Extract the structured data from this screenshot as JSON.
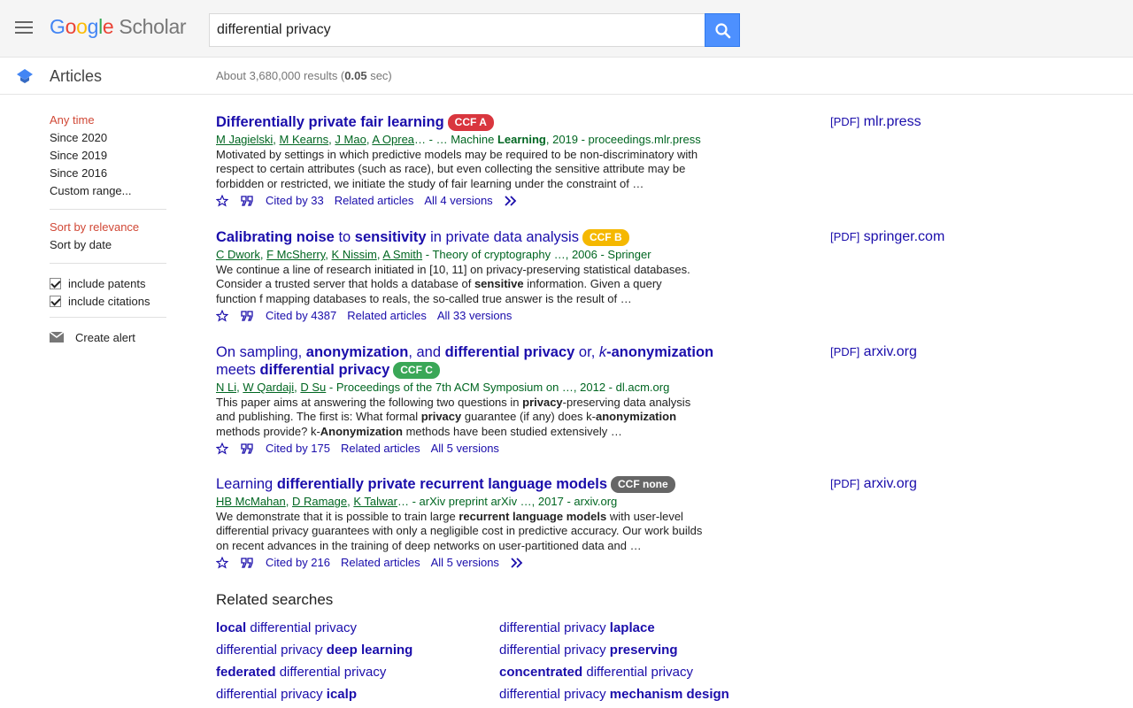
{
  "header": {
    "logo_google": [
      "G",
      "o",
      "o",
      "g",
      "l",
      "e"
    ],
    "logo_scholar": "Scholar",
    "search_value": "differential privacy"
  },
  "subheader": {
    "section_title": "Articles",
    "result_count_prefix": "About 3,680,000 results (",
    "result_count_time": "0.05",
    "result_count_suffix": " sec)"
  },
  "sidebar": {
    "time_filters": [
      "Any time",
      "Since 2020",
      "Since 2019",
      "Since 2016",
      "Custom range..."
    ],
    "sort_options": [
      "Sort by relevance",
      "Sort by date"
    ],
    "checkboxes": [
      "include patents",
      "include citations"
    ],
    "create_alert": "Create alert"
  },
  "results": [
    {
      "title_parts": [
        [
          "Differentially private fair learning",
          true
        ]
      ],
      "badge": "CCF A",
      "badge_color": "#d9363e",
      "meta_authors": [
        "M Jagielski",
        "M Kearns",
        "J Mao",
        "A Oprea"
      ],
      "meta_rest_before": "… - … Machine ",
      "meta_rest_bold": "Learning",
      "meta_rest_after": ", 2019 - proceedings.mlr.press",
      "snippet_parts": [
        [
          "Motivated by settings in which predictive models may be required to be non-discriminatory with respect to certain attributes (such as race), but even collecting the sensitive attribute may be forbidden or restricted, we initiate the study of fair learning under the constraint of …",
          false
        ]
      ],
      "cited": "Cited by 33",
      "related": "Related articles",
      "versions": "All 4 versions",
      "pdf_tag": "[PDF]",
      "pdf_site": "mlr.press"
    },
    {
      "title_parts": [
        [
          "Calibrating noise",
          true
        ],
        [
          " to ",
          false
        ],
        [
          "sensitivity",
          true
        ],
        [
          " in private data analysis",
          false
        ]
      ],
      "badge": "CCF B",
      "badge_color": "#f5b800",
      "meta_authors": [
        "C Dwork",
        "F McSherry",
        "K Nissim",
        "A Smith"
      ],
      "meta_rest_before": " - Theory of cryptography …, 2006 - Springer",
      "meta_rest_bold": "",
      "meta_rest_after": "",
      "snippet_parts": [
        [
          "We continue a line of research initiated in [10, 11] on privacy-preserving statistical databases. Consider a trusted server that holds a database of ",
          false
        ],
        [
          "sensitive",
          true
        ],
        [
          " information. Given a query function f mapping databases to reals, the so-called true answer is the result of …",
          false
        ]
      ],
      "cited": "Cited by 4387",
      "related": "Related articles",
      "versions": "All 33 versions",
      "pdf_tag": "[PDF]",
      "pdf_site": "springer.com"
    },
    {
      "title_parts": [
        [
          "On sampling, ",
          false
        ],
        [
          "anonymization",
          true
        ],
        [
          ", and ",
          false
        ],
        [
          "differential privacy",
          true
        ],
        [
          " or, ",
          false
        ],
        [
          "k",
          false,
          true
        ],
        [
          "-anonymization",
          true
        ],
        [
          " meets ",
          false
        ],
        [
          "differential privacy",
          true
        ]
      ],
      "badge": "CCF C",
      "badge_color": "#3aa757",
      "meta_authors": [
        "N Li",
        "W Qardaji",
        "D Su"
      ],
      "meta_rest_before": " - Proceedings of the 7th ACM Symposium on …, 2012 - dl.acm.org",
      "meta_rest_bold": "",
      "meta_rest_after": "",
      "snippet_parts": [
        [
          "This paper aims at answering the following two questions in ",
          false
        ],
        [
          "privacy",
          true
        ],
        [
          "-preserving data analysis and publishing. The first is: What formal ",
          false
        ],
        [
          "privacy",
          true
        ],
        [
          " guarantee (if any) does k-",
          false
        ],
        [
          "anonymization",
          true
        ],
        [
          " methods provide? k-",
          false
        ],
        [
          "Anonymization",
          true
        ],
        [
          " methods have been studied extensively …",
          false
        ]
      ],
      "cited": "Cited by 175",
      "related": "Related articles",
      "versions": "All 5 versions",
      "pdf_tag": "[PDF]",
      "pdf_site": "arxiv.org"
    },
    {
      "title_parts": [
        [
          "Learning ",
          false
        ],
        [
          "differentially private recurrent language models",
          true
        ]
      ],
      "badge": "CCF none",
      "badge_color": "#666666",
      "meta_authors": [
        "HB McMahan",
        "D Ramage",
        "K Talwar"
      ],
      "meta_rest_before": "… - arXiv preprint arXiv …, 2017 - arxiv.org",
      "meta_rest_bold": "",
      "meta_rest_after": "",
      "snippet_parts": [
        [
          "We demonstrate that it is possible to train large ",
          false
        ],
        [
          "recurrent language models",
          true
        ],
        [
          " with user-level differential privacy guarantees with only a negligible cost in predictive accuracy. Our work builds on recent advances in the training of deep networks on user-partitioned data and …",
          false
        ]
      ],
      "cited": "Cited by 216",
      "related": "Related articles",
      "versions": "All 5 versions",
      "pdf_tag": "[PDF]",
      "pdf_site": "arxiv.org"
    }
  ],
  "related_searches": {
    "title": "Related searches",
    "items": [
      [
        [
          "local",
          true
        ],
        [
          " differential privacy",
          false
        ]
      ],
      [
        [
          "differential privacy ",
          false
        ],
        [
          "laplace",
          true
        ]
      ],
      [
        [
          "differential privacy ",
          false
        ],
        [
          "deep learning",
          true
        ]
      ],
      [
        [
          "differential privacy ",
          false
        ],
        [
          "preserving",
          true
        ]
      ],
      [
        [
          "federated",
          true
        ],
        [
          " differential privacy",
          false
        ]
      ],
      [
        [
          "concentrated",
          true
        ],
        [
          " differential privacy",
          false
        ]
      ],
      [
        [
          "differential privacy ",
          false
        ],
        [
          "icalp",
          true
        ]
      ],
      [
        [
          "differential privacy ",
          false
        ],
        [
          "mechanism design",
          true
        ]
      ]
    ]
  },
  "icons": {
    "menu": "hamburger-icon",
    "search": "search-icon",
    "articles": "graduation-cap-icon",
    "star": "star-icon",
    "cite": "quote-icon",
    "more": "double-chevron-icon",
    "alert": "envelope-icon"
  }
}
